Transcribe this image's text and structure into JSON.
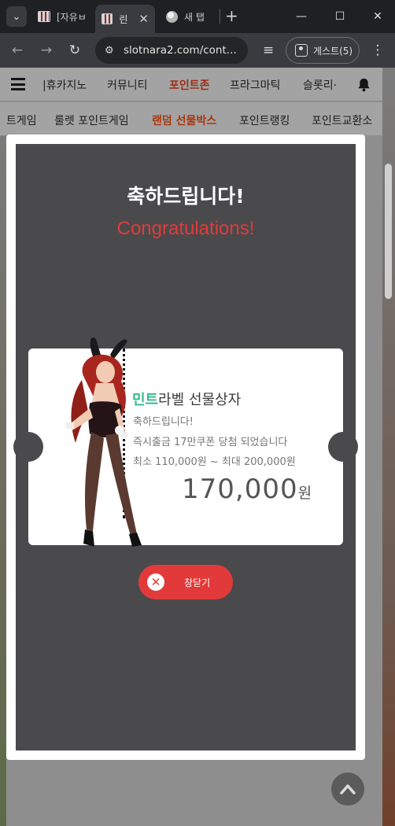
{
  "browser": {
    "tabs": [
      {
        "title": "[자유ㅂ",
        "active": false
      },
      {
        "title": "린",
        "active": true
      },
      {
        "title": "새 탭",
        "active": false
      }
    ],
    "tab_list_icon": "chevron-down-icon",
    "new_tab_symbol": "+",
    "url": "slotnara2.com/cont...",
    "profile_label": "게스트(5)",
    "window": {
      "minimize": "—",
      "maximize": "☐",
      "close": "✕"
    }
  },
  "site": {
    "nav_primary": [
      {
        "label": "|휴카지노",
        "highlight": false
      },
      {
        "label": "커뮤니티",
        "highlight": false
      },
      {
        "label": "포인트존",
        "highlight": true
      },
      {
        "label": "프라그마틱",
        "highlight": false
      },
      {
        "label": "슬롯리·",
        "highlight": false
      }
    ],
    "nav_secondary": [
      {
        "label": "트게임",
        "highlight": false
      },
      {
        "label": "룰렛 포인트게임",
        "highlight": false
      },
      {
        "label": "랜덤 선물박스",
        "highlight": true
      },
      {
        "label": "포인트랭킹",
        "highlight": false
      },
      {
        "label": "포인트교환소",
        "highlight": false
      }
    ]
  },
  "modal": {
    "heading": "축하드립니다!",
    "subheading": "Congratulations!",
    "ticket": {
      "brand": "민트",
      "title_rest": "라벨 선물상자",
      "line1": "축하드립니다!",
      "line2": "즉시출금 17만쿠폰 당첨 되었습니다",
      "line3": "최소 110,000원 ~ 최대 200,000원",
      "amount": "170,000",
      "unit": "원"
    },
    "close_label": "창닫기"
  },
  "colors": {
    "accent_red": "#e23a3a",
    "brand_green": "#33bb88",
    "nav_highlight": "#9c2e16",
    "modal_bg": "#4a4a4c"
  }
}
